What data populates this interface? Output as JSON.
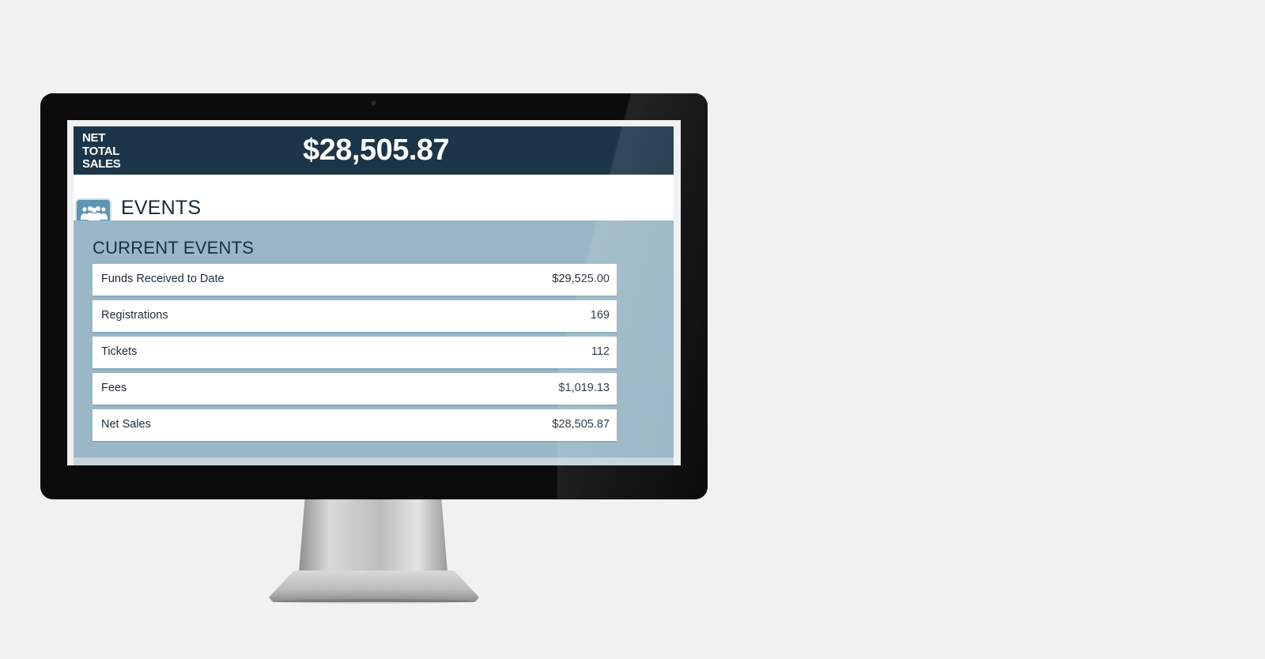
{
  "header": {
    "label": "NET\nTOTAL\nSALES",
    "amount": "$28,505.87"
  },
  "events": {
    "icon": "group-icon",
    "title": "EVENTS"
  },
  "current_events": {
    "title": "CURRENT EVENTS",
    "rows": [
      {
        "label": "Funds Received to Date",
        "value": "$29,525.00"
      },
      {
        "label": "Registrations",
        "value": "169"
      },
      {
        "label": "Tickets",
        "value": "112"
      },
      {
        "label": "Fees",
        "value": "$1,019.13"
      },
      {
        "label": "Net Sales",
        "value": "$28,505.87"
      }
    ]
  },
  "colors": {
    "header_bg": "#1c3549",
    "panel_bg": "#9ab7c5",
    "icon_bg": "#5e95b2",
    "page_bg": "#f1f1f1"
  }
}
